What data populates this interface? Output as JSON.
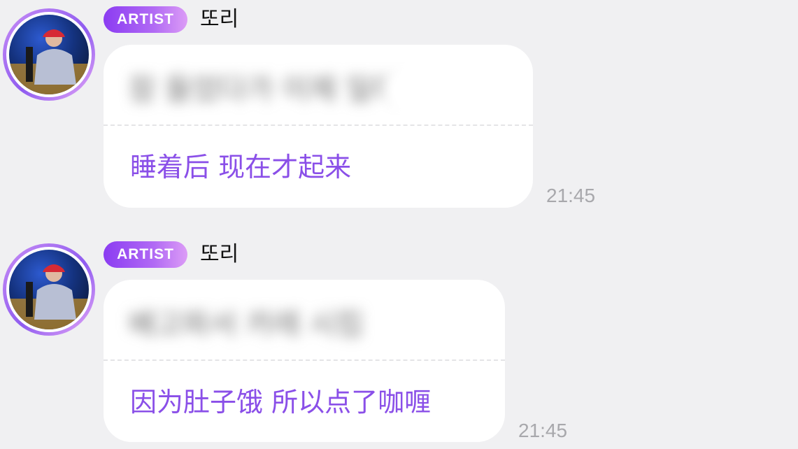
{
  "messages": [
    {
      "badge": "ARTIST",
      "name": "또리",
      "original_blurred": "잠 들었다가 이제 일어났어요",
      "translation": "睡着后 现在才起来",
      "time": "21:45"
    },
    {
      "badge": "ARTIST",
      "name": "또리",
      "original_blurred": "배고파서 카레 시킴",
      "translation": "因为肚子饿 所以点了咖喱",
      "time": "21:45"
    }
  ],
  "colors": {
    "background": "#f0f0f2",
    "bubble": "#ffffff",
    "translation_text": "#8a4fe8",
    "badge_start": "#8b3cf2",
    "badge_end": "#dc9cf6",
    "timestamp": "#a8a8ac"
  }
}
